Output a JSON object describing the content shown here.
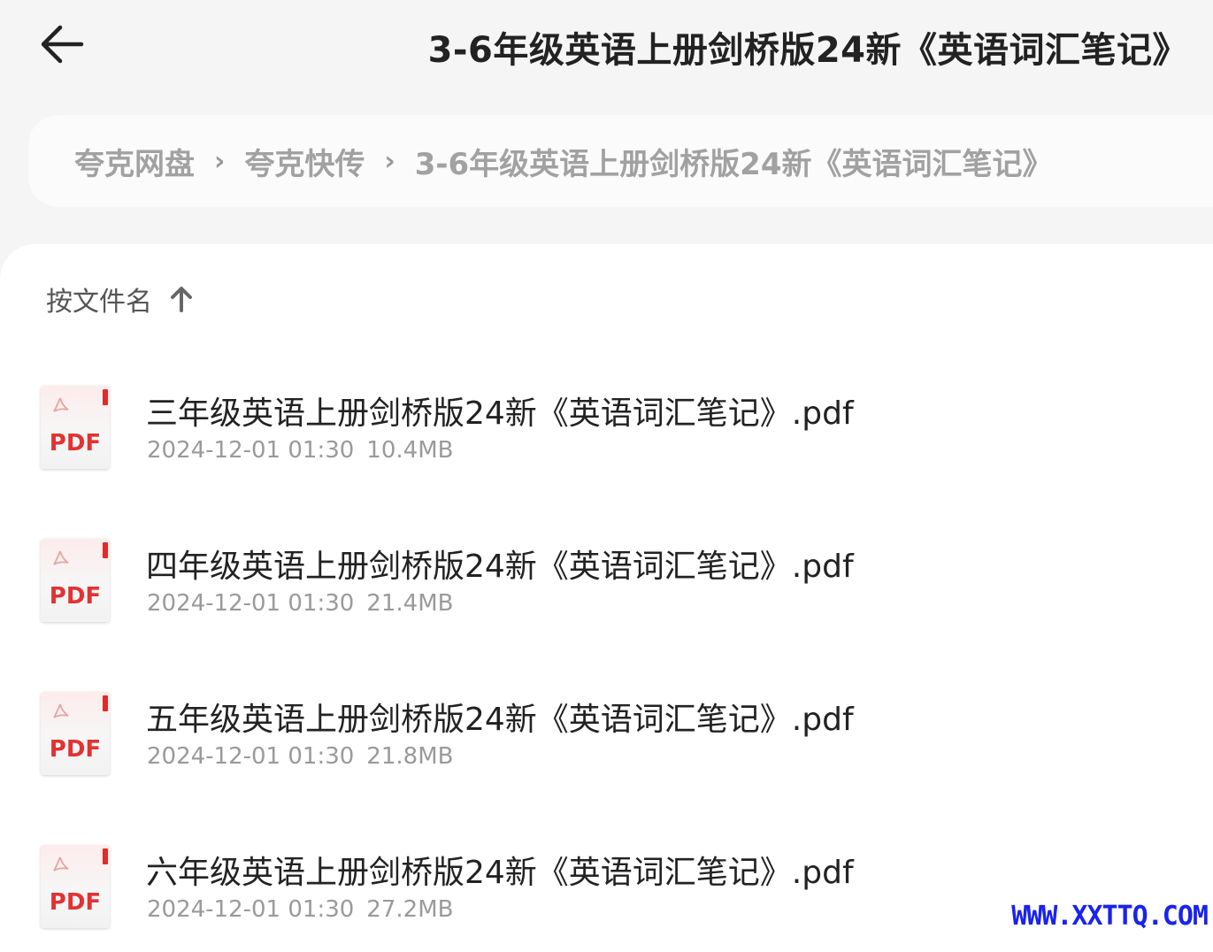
{
  "header": {
    "title": "3-6年级英语上册剑桥版24新《英语词汇笔记》"
  },
  "breadcrumb": {
    "items": [
      "夸克网盘",
      "夸克快传",
      "3-6年级英语上册剑桥版24新《英语词汇笔记》"
    ],
    "separator": "›"
  },
  "sort": {
    "label": "按文件名"
  },
  "files": [
    {
      "name": "三年级英语上册剑桥版24新《英语词汇笔记》.pdf",
      "date": "2024-12-01 01:30",
      "size": "10.4MB",
      "icon_label": "PDF"
    },
    {
      "name": "四年级英语上册剑桥版24新《英语词汇笔记》.pdf",
      "date": "2024-12-01 01:30",
      "size": "21.4MB",
      "icon_label": "PDF"
    },
    {
      "name": "五年级英语上册剑桥版24新《英语词汇笔记》.pdf",
      "date": "2024-12-01 01:30",
      "size": "21.8MB",
      "icon_label": "PDF"
    },
    {
      "name": "六年级英语上册剑桥版24新《英语词汇笔记》.pdf",
      "date": "2024-12-01 01:30",
      "size": "27.2MB",
      "icon_label": "PDF"
    }
  ],
  "watermark": "WWW.XXTTQ.COM",
  "colors": {
    "background": "#f5f5f5",
    "panel": "#ffffff",
    "pdf_red": "#e23232",
    "watermark_blue": "#1a22ee"
  }
}
